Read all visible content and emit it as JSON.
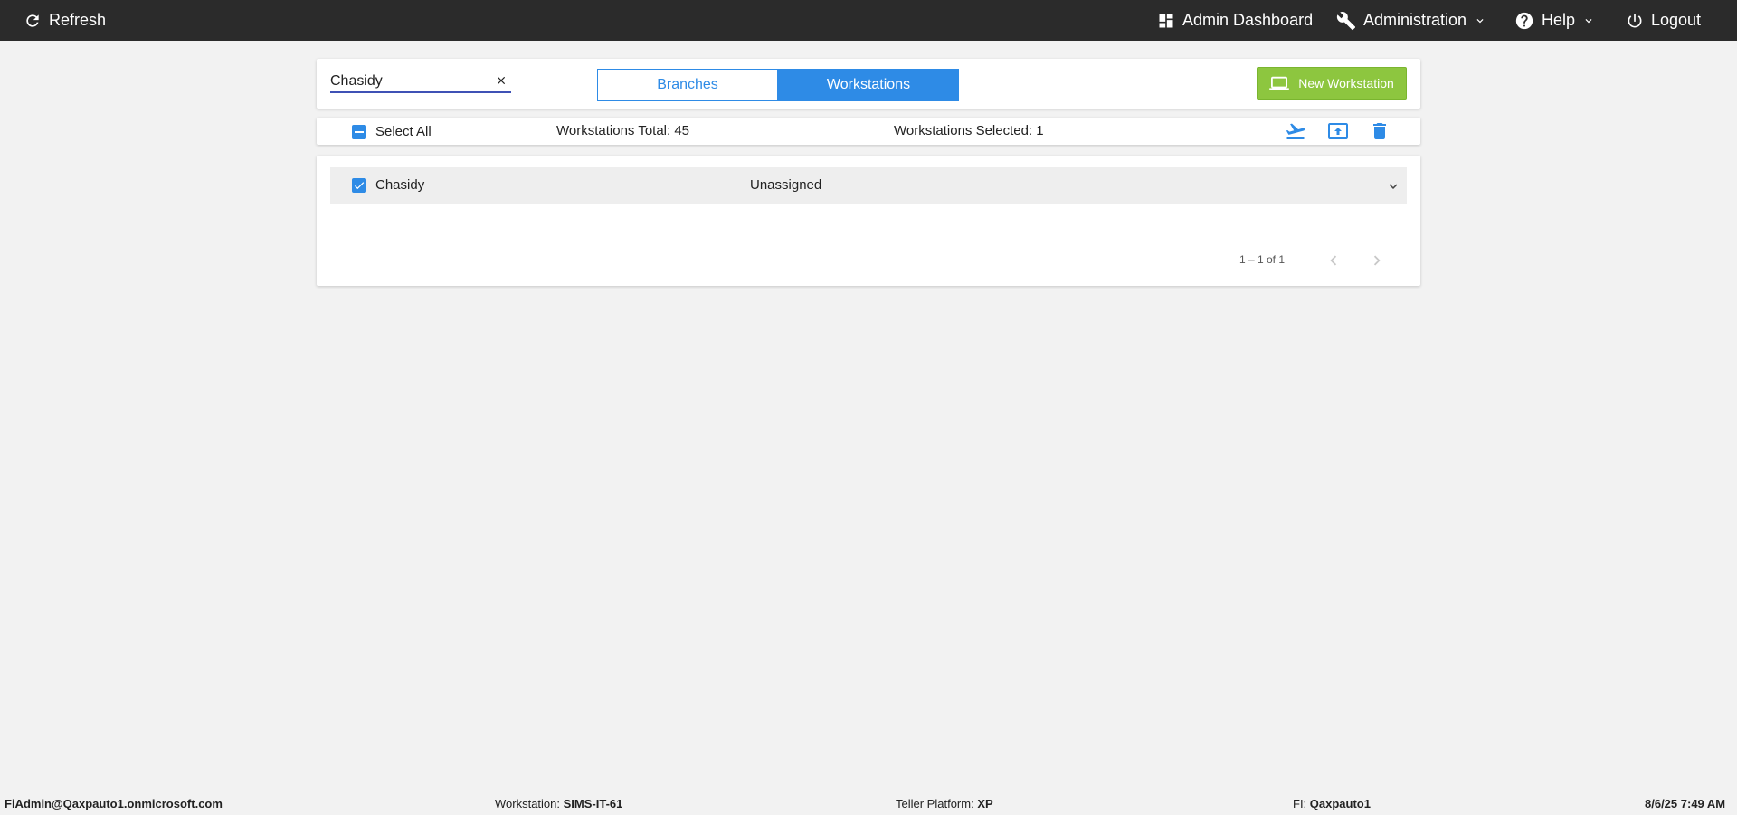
{
  "topbar": {
    "refresh_label": "Refresh",
    "admin_dashboard_label": "Admin Dashboard",
    "administration_label": "Administration",
    "help_label": "Help",
    "logout_label": "Logout"
  },
  "search": {
    "value": "Chasidy"
  },
  "tabs": {
    "branches_label": "Branches",
    "workstations_label": "Workstations",
    "active": "Workstations"
  },
  "new_workstation_label": "New Workstation",
  "selection_bar": {
    "select_all_label": "Select All",
    "total_text": "Workstations Total: 45",
    "selected_text": "Workstations Selected: 1"
  },
  "list": {
    "rows": [
      {
        "name": "Chasidy",
        "status": "Unassigned",
        "checked": true
      }
    ],
    "range_text": "1 – 1 of 1"
  },
  "footer": {
    "user": "FiAdmin@Qaxpauto1.onmicrosoft.com",
    "workstation_label": "Workstation:",
    "workstation_value": "SIMS-IT-61",
    "platform_label": "Teller Platform:",
    "platform_value": "XP",
    "fi_label": "FI:",
    "fi_value": "Qaxpauto1",
    "datetime": "8/6/25 7:49 AM"
  },
  "colors": {
    "accent": "#2e8be6",
    "new_button": "#8dc63f",
    "topbar": "#2b2b2b"
  }
}
